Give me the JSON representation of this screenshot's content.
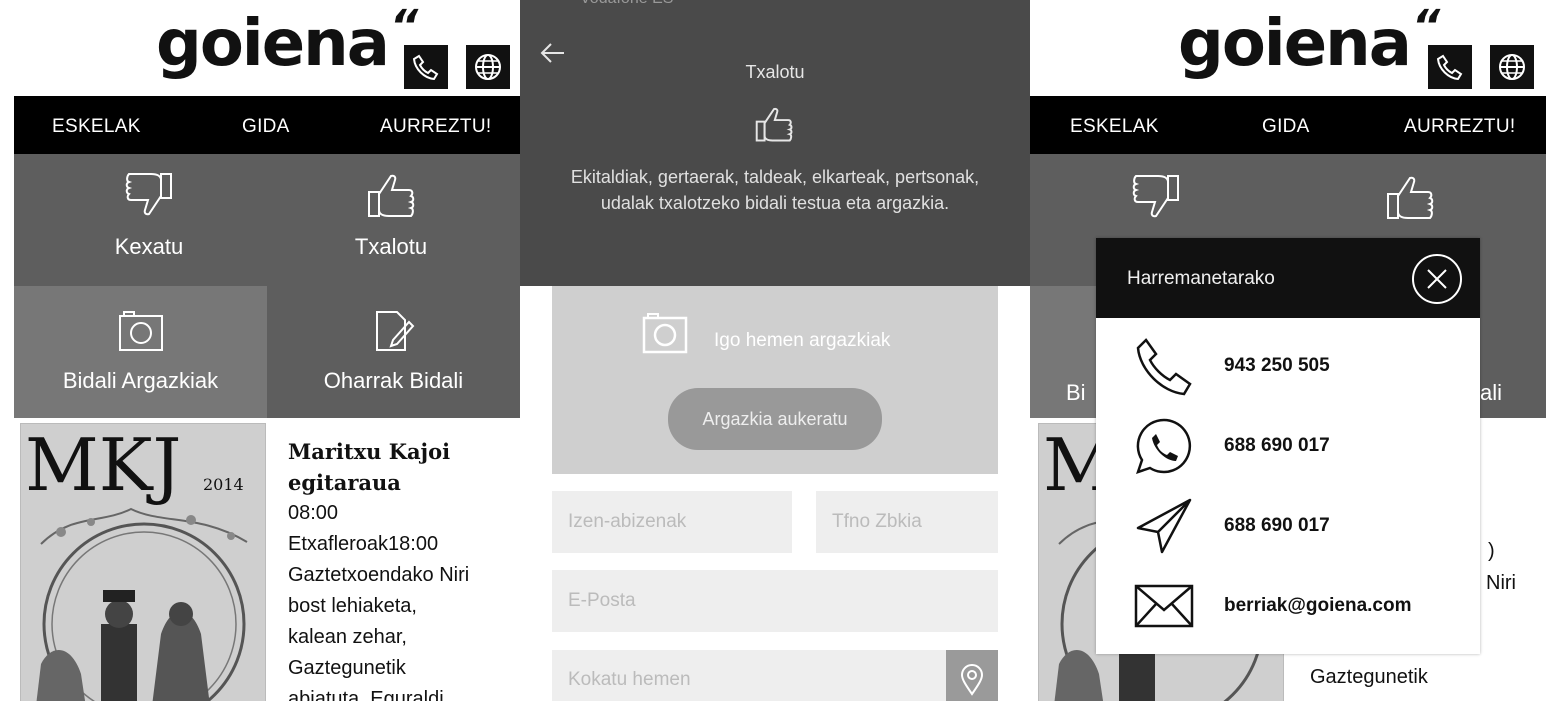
{
  "brand": {
    "logo_text": "goiena",
    "logo_mark": "“"
  },
  "nav": {
    "items": [
      "ESKELAK",
      "GIDA",
      "AURREZTU!"
    ]
  },
  "tiles": [
    {
      "label": "Kexatu",
      "icon": "thumbs-down-icon"
    },
    {
      "label": "Txalotu",
      "icon": "thumbs-up-icon"
    },
    {
      "label": "Bidali Argazkiak",
      "icon": "camera-icon"
    },
    {
      "label": "Oharrak Bidali",
      "icon": "edit-note-icon"
    }
  ],
  "article": {
    "image_text": "MKJ",
    "image_year": "2014",
    "title": "Maritxu Kajoi egitaraua",
    "lines": [
      "08:00",
      "Etxafleroak18:00",
      "Gaztetxoendako Niri",
      "bost lehiaketa,",
      "kalean zehar,",
      "Gaztegunetik",
      "abiatuta. Eguraldi"
    ]
  },
  "form_screen": {
    "status_text": "Vodafone ES",
    "title": "Txalotu",
    "description": "Ekitaldiak, gertaerak, taldeak, elkarteak, pertsonak, udalak txalotzeko bidali testua eta argazkia.",
    "upload_label": "Igo hemen argazkiak",
    "upload_button": "Argazkia aukeratu",
    "name_placeholder": "Izen-abizenak",
    "phone_placeholder": "Tfno Zbkia",
    "email_placeholder": "E-Posta",
    "location_placeholder": "Kokatu hemen"
  },
  "contact_modal": {
    "title": "Harremanetarako",
    "rows": [
      {
        "icon": "phone-icon",
        "value": "943 250 505"
      },
      {
        "icon": "whatsapp-icon",
        "value": "688 690 017"
      },
      {
        "icon": "send-icon",
        "value": "688 690 017"
      },
      {
        "icon": "mail-icon",
        "value": "berriak@goiena.com"
      }
    ]
  },
  "behind_modal": {
    "tile_left_partial": "Bi",
    "tile_right_partial": "ali",
    "text_partial_1": ")",
    "text_partial_2": "Niri",
    "text_partial_3": "Gaztegunetik"
  },
  "colors": {
    "tile_dark": "#5e5e5e",
    "tile_mid": "#777777",
    "nav_bg": "#000000"
  }
}
